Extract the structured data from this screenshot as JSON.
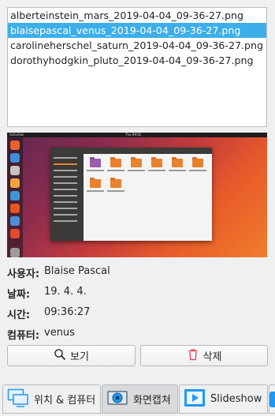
{
  "file_list": {
    "items": [
      "alberteinstein_mars_2019-04-04_09-36-27.png",
      "blaisepascal_venus_2019-04-04_09-36-27.png",
      "carolineherschel_saturn_2019-04-04_09-36-27.png",
      "dorothyhodgkin_pluto_2019-04-04_09-36-27.png"
    ],
    "selected_index": 1
  },
  "preview": {
    "topbar_left": "Activities",
    "topbar_center": "Thu 09:02",
    "file_manager_title": "Home",
    "sidebar_items": [
      "Recent",
      "Home",
      "Desktop",
      "Documents",
      "Downloads",
      "Music",
      "Pictures",
      "Videos",
      "Trash",
      "Network",
      "+ Other Locations"
    ],
    "folders": [
      "Desktop",
      "Documents",
      "Downloads",
      "Music",
      "Pictures",
      "Public",
      "Templates",
      "Videos",
      "Examples"
    ]
  },
  "info": {
    "user_label": "사용자:",
    "user_value": "Blaise Pascal",
    "date_label": "날짜:",
    "date_value": "19. 4. 4.",
    "time_label": "시간:",
    "time_value": "09:36:27",
    "computer_label": "컴퓨터:",
    "computer_value": "venus"
  },
  "buttons": {
    "view_label": "보기",
    "delete_label": "삭제"
  },
  "tabs": [
    {
      "label": "위치 & 컴퓨터",
      "icon": "monitor-icon",
      "active": false
    },
    {
      "label": "화면캡쳐",
      "icon": "camera-icon",
      "active": true
    },
    {
      "label": "Slideshow",
      "icon": "slideshow-icon",
      "active": false
    }
  ],
  "colors": {
    "selection": "#3daee9",
    "delete_icon": "#da4453",
    "icon_blue": "#1d99f3"
  }
}
